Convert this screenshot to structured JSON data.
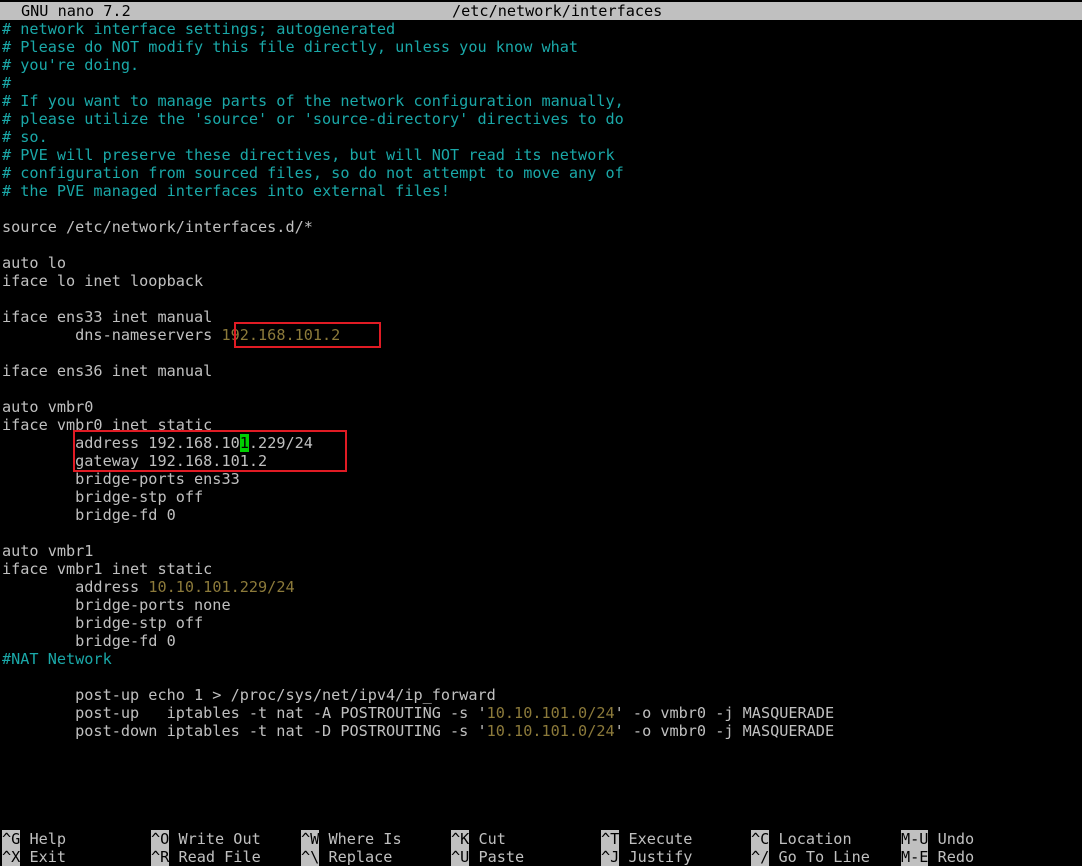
{
  "titlebar": {
    "app": "GNU nano 7.2",
    "file": "/etc/network/interfaces"
  },
  "lines": [
    [
      {
        "t": "# network interface settings; autogenerated",
        "c": "cmt"
      }
    ],
    [
      {
        "t": "# Please do NOT modify this file directly, unless you know what",
        "c": "cmt"
      }
    ],
    [
      {
        "t": "# you're doing.",
        "c": "cmt"
      }
    ],
    [
      {
        "t": "#",
        "c": "cmt"
      }
    ],
    [
      {
        "t": "# If you want to manage parts of the network configuration manually,",
        "c": "cmt"
      }
    ],
    [
      {
        "t": "# please utilize the 'source' or 'source-directory' directives to do",
        "c": "cmt"
      }
    ],
    [
      {
        "t": "# so.",
        "c": "cmt"
      }
    ],
    [
      {
        "t": "# PVE will preserve these directives, but will NOT read its network",
        "c": "cmt"
      }
    ],
    [
      {
        "t": "# configuration from sourced files, so do not attempt to move any of",
        "c": "cmt"
      }
    ],
    [
      {
        "t": "# the PVE managed interfaces into external files!",
        "c": "cmt"
      }
    ],
    [],
    [
      {
        "t": "source /etc/network/interfaces.d/*"
      }
    ],
    [],
    [
      {
        "t": "auto lo"
      }
    ],
    [
      {
        "t": "iface lo inet loopback"
      }
    ],
    [],
    [
      {
        "t": "iface ens33 inet manual"
      }
    ],
    [
      {
        "t": "        dns-nameservers "
      },
      {
        "t": "192.168.101.2",
        "c": "num"
      }
    ],
    [],
    [
      {
        "t": "iface ens36 inet manual"
      }
    ],
    [],
    [
      {
        "t": "auto vmbr0"
      }
    ],
    [
      {
        "t": "iface vmbr0 inet static"
      }
    ],
    [
      {
        "t": "        address 192.168.10"
      },
      {
        "t": "1",
        "c": "cur"
      },
      {
        "t": ".229/24"
      }
    ],
    [
      {
        "t": "        gateway 192.168.101.2"
      }
    ],
    [
      {
        "t": "        bridge-ports ens33"
      }
    ],
    [
      {
        "t": "        bridge-stp off"
      }
    ],
    [
      {
        "t": "        bridge-fd 0"
      }
    ],
    [],
    [
      {
        "t": "auto vmbr1"
      }
    ],
    [
      {
        "t": "iface vmbr1 inet static"
      }
    ],
    [
      {
        "t": "        address "
      },
      {
        "t": "10.10.101.229/24",
        "c": "num"
      }
    ],
    [
      {
        "t": "        bridge-ports none"
      }
    ],
    [
      {
        "t": "        bridge-stp off"
      }
    ],
    [
      {
        "t": "        bridge-fd 0"
      }
    ],
    [
      {
        "t": "#NAT Network",
        "c": "cmt"
      }
    ],
    [],
    [
      {
        "t": "        post-up echo 1 > /proc/sys/net/ipv4/ip_forward"
      }
    ],
    [
      {
        "t": "        post-up   iptables -t nat -A POSTROUTING -s '"
      },
      {
        "t": "10.10.101.0/24",
        "c": "num"
      },
      {
        "t": "' -o vmbr0 -j MASQUERADE"
      }
    ],
    [
      {
        "t": "        post-down iptables -t nat -D POSTROUTING -s '"
      },
      {
        "t": "10.10.101.0/24",
        "c": "num"
      },
      {
        "t": "' -o vmbr0 -j MASQUERADE"
      }
    ]
  ],
  "shortcuts": [
    [
      {
        "key": "^G",
        "label": "Help"
      },
      {
        "key": "^O",
        "label": "Write Out"
      },
      {
        "key": "^W",
        "label": "Where Is"
      },
      {
        "key": "^K",
        "label": "Cut"
      },
      {
        "key": "^T",
        "label": "Execute"
      },
      {
        "key": "^C",
        "label": "Location"
      },
      {
        "key": "M-U",
        "label": "Undo"
      }
    ],
    [
      {
        "key": "^X",
        "label": "Exit"
      },
      {
        "key": "^R",
        "label": "Read File"
      },
      {
        "key": "^\\",
        "label": "Replace"
      },
      {
        "key": "^U",
        "label": "Paste"
      },
      {
        "key": "^J",
        "label": "Justify"
      },
      {
        "key": "^/",
        "label": "Go To Line"
      },
      {
        "key": "M-E",
        "label": "Redo"
      }
    ]
  ],
  "colors": {
    "comment": "#1aa8a8",
    "number": "#8c7a3a",
    "cursor": "#00d000",
    "highlight_box": "#e01b24"
  }
}
